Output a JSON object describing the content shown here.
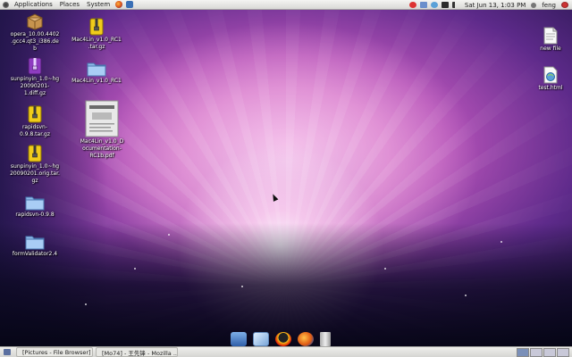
{
  "top_panel": {
    "menus": [
      "Applications",
      "Places",
      "System"
    ],
    "clock": "Sat Jun 13,  1:03 PM",
    "user": "feng"
  },
  "desktop_icons": [
    {
      "label": "opera_10.00.4402.gcc4.qt3_i386.deb",
      "icon": "package-icon"
    },
    {
      "label": "sunpinyin_1.0~hg20090201-1.diff.gz",
      "icon": "archive-icon"
    },
    {
      "label": "rapidsvn-0.9.8.tar.gz",
      "icon": "archive-icon"
    },
    {
      "label": "sunpinyin_1.0~hg20090201.orig.tar.gz",
      "icon": "archive-icon"
    },
    {
      "label": "rapidsvn-0.9.8",
      "icon": "folder-icon"
    },
    {
      "label": "formValidator2.4",
      "icon": "folder-icon"
    },
    {
      "label": "Mac4Lin_v1.0_RC1.tar.gz",
      "icon": "archive-icon"
    },
    {
      "label": "Mac4Lin_v1.0_RC1",
      "icon": "folder-icon"
    },
    {
      "label": "Mac4Lin_v1.0_Documentation-RC1b.pdf",
      "icon": "pdf-icon"
    },
    {
      "label": "new file",
      "icon": "text-file-icon"
    },
    {
      "label": "test.html",
      "icon": "html-file-icon"
    }
  ],
  "dock_items": [
    "finder-icon",
    "box-icon",
    "penguin-icon",
    "firefox-icon",
    "trash-icon"
  ],
  "taskbar": {
    "tasks": [
      {
        "label": "[Pictures - File Browser]"
      },
      {
        "label": "[Mo74] - 王先锋 - Mozilla ..."
      }
    ]
  },
  "colors": {
    "panel": "#e4e4e1",
    "wallpaper_center": "#e887d8",
    "wallpaper_edge": "#1a1240"
  }
}
